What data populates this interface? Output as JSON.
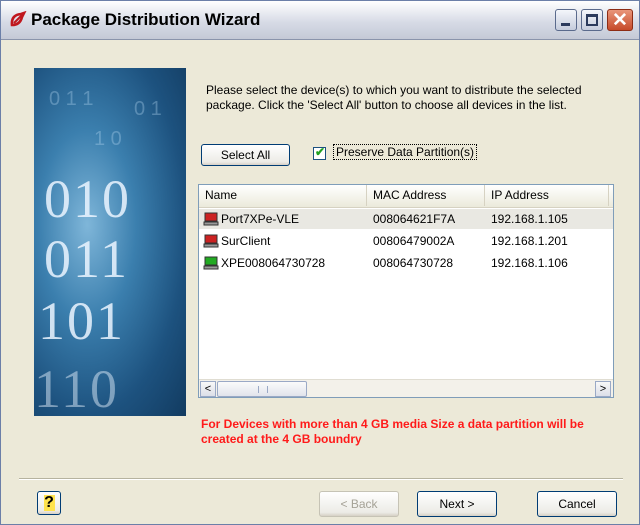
{
  "window": {
    "title": "Package Distribution Wizard",
    "close_glyph": "✕"
  },
  "side_image": {
    "digits": [
      "010",
      "011",
      "101",
      "110"
    ]
  },
  "intro_text": "Please select the device(s) to which you want to distribute the selected package.  Click the 'Select All' button to choose all devices in the list.",
  "select_all_label": "Select All",
  "preserve_partition": {
    "label": "Preserve Data Partition(s)",
    "checked": true,
    "mark": "✔"
  },
  "device_list": {
    "columns": [
      "Name",
      "MAC Address",
      "IP Address"
    ],
    "rows": [
      {
        "name": "Port7XPe-VLE",
        "mac": "008064621F7A",
        "ip": "192.168.1.105",
        "icon": "computer-red-icon",
        "selected": true
      },
      {
        "name": "SurClient",
        "mac": "00806479002A",
        "ip": "192.168.1.201",
        "icon": "computer-red-icon",
        "selected": false
      },
      {
        "name": "XPE008064730728",
        "mac": "008064730728",
        "ip": "192.168.1.106",
        "icon": "computer-green-icon",
        "selected": false
      }
    ],
    "scroll_left": "<",
    "scroll_right": ">"
  },
  "warning_text": "For Devices with more than 4 GB media Size a data partition will be created at the 4 GB boundry",
  "help_glyph": "?",
  "buttons": {
    "back": "< Back",
    "next": "Next >",
    "cancel": "Cancel"
  },
  "colors": {
    "warning": "#ff1a1a",
    "status_red": "#cc2222",
    "status_green": "#22aa22"
  }
}
